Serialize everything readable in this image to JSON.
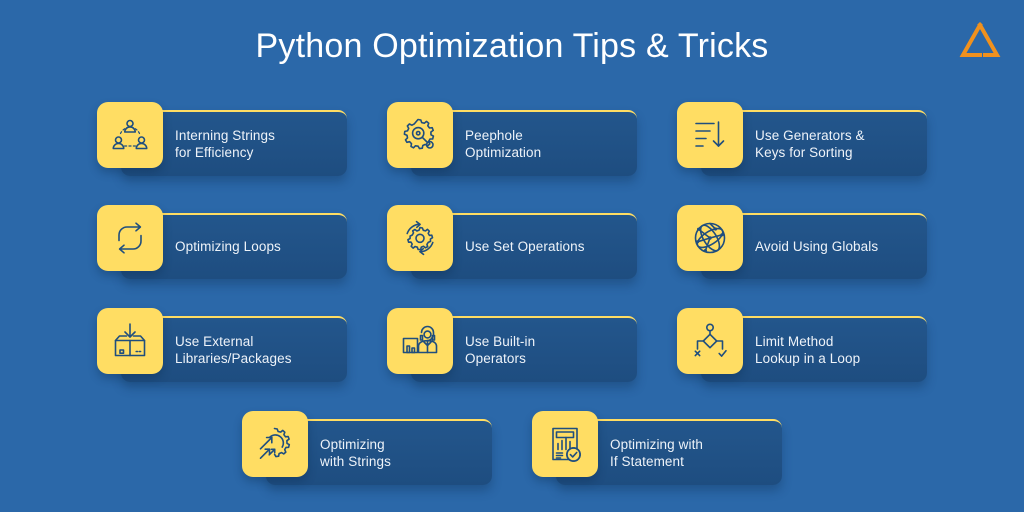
{
  "header": {
    "title": "Python Optimization Tips & Tricks",
    "logo_icon": "triangle-logo-icon",
    "logo_color": "#f0911e"
  },
  "theme": {
    "background": "#2b68a9",
    "card_background": "#1e4f82",
    "accent": "#ffdd63",
    "text": "#eef3f9",
    "icon_stroke": "#1f4e7e"
  },
  "rows": [
    {
      "cards": [
        {
          "icon": "people-network-icon",
          "lines": [
            "Interning Strings",
            "for Efficiency"
          ]
        },
        {
          "icon": "gear-magnifier-icon",
          "lines": [
            "Peephole",
            "Optimization"
          ]
        },
        {
          "icon": "sort-descending-icon",
          "lines": [
            "Use Generators &",
            "Keys for Sorting"
          ]
        }
      ]
    },
    {
      "cards": [
        {
          "icon": "loop-arrows-icon",
          "lines": [
            "Optimizing Loops"
          ]
        },
        {
          "icon": "gear-refresh-icon",
          "lines": [
            "Use Set Operations"
          ]
        },
        {
          "icon": "globe-network-icon",
          "lines": [
            "Avoid Using Globals"
          ]
        }
      ]
    },
    {
      "cards": [
        {
          "icon": "package-download-icon",
          "lines": [
            "Use External",
            "Libraries/Packages"
          ]
        },
        {
          "icon": "headset-operator-icon",
          "lines": [
            "Use Built-in",
            "Operators"
          ]
        },
        {
          "icon": "decision-flowchart-icon",
          "lines": [
            "Limit Method",
            "Lookup in a Loop"
          ]
        }
      ]
    },
    {
      "cards": [
        {
          "icon": "gear-arrows-icon",
          "lines": [
            "Optimizing",
            "with Strings"
          ]
        },
        {
          "icon": "report-check-icon",
          "lines": [
            "Optimizing with",
            "If Statement"
          ]
        }
      ]
    }
  ]
}
